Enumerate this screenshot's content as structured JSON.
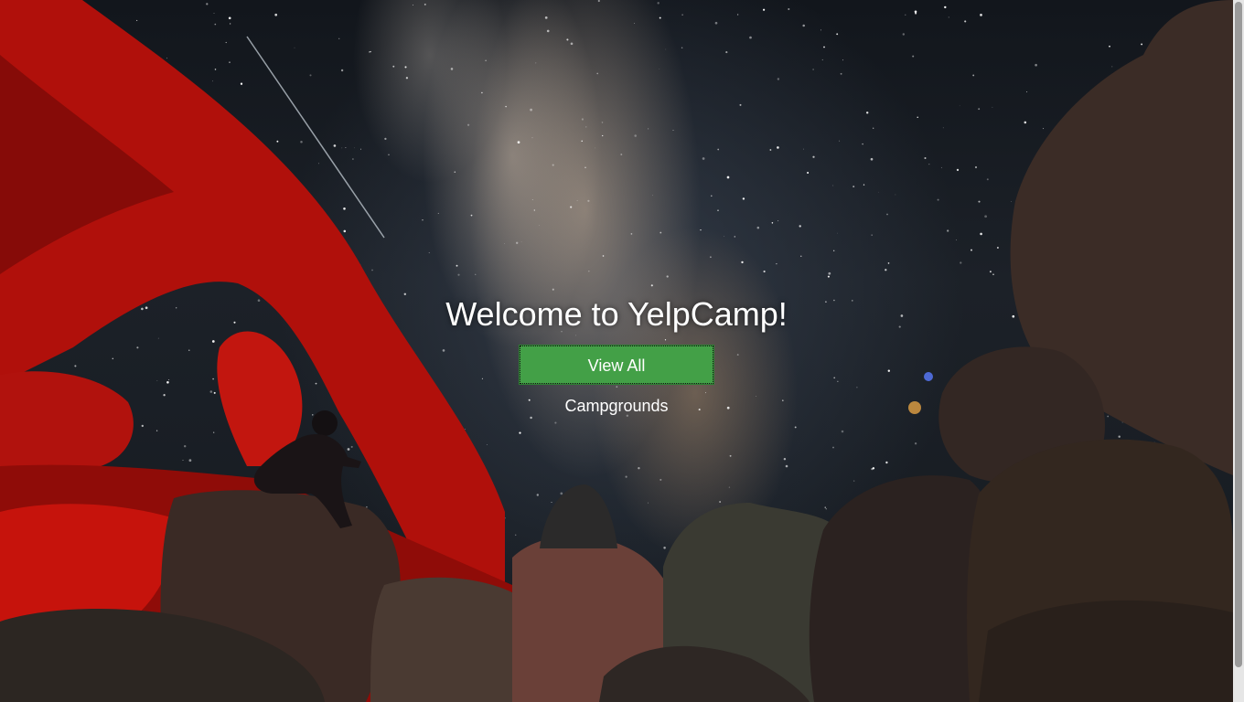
{
  "hero": {
    "title": "Welcome to YelpCamp!",
    "button_label": "View All Campgrounds"
  },
  "colors": {
    "button_bg": "#43a047",
    "title_text": "#ffffff",
    "rock_red": "#c0120c",
    "sky": "#1a1f26"
  },
  "background": {
    "description_icon": "night-sky-photo"
  }
}
